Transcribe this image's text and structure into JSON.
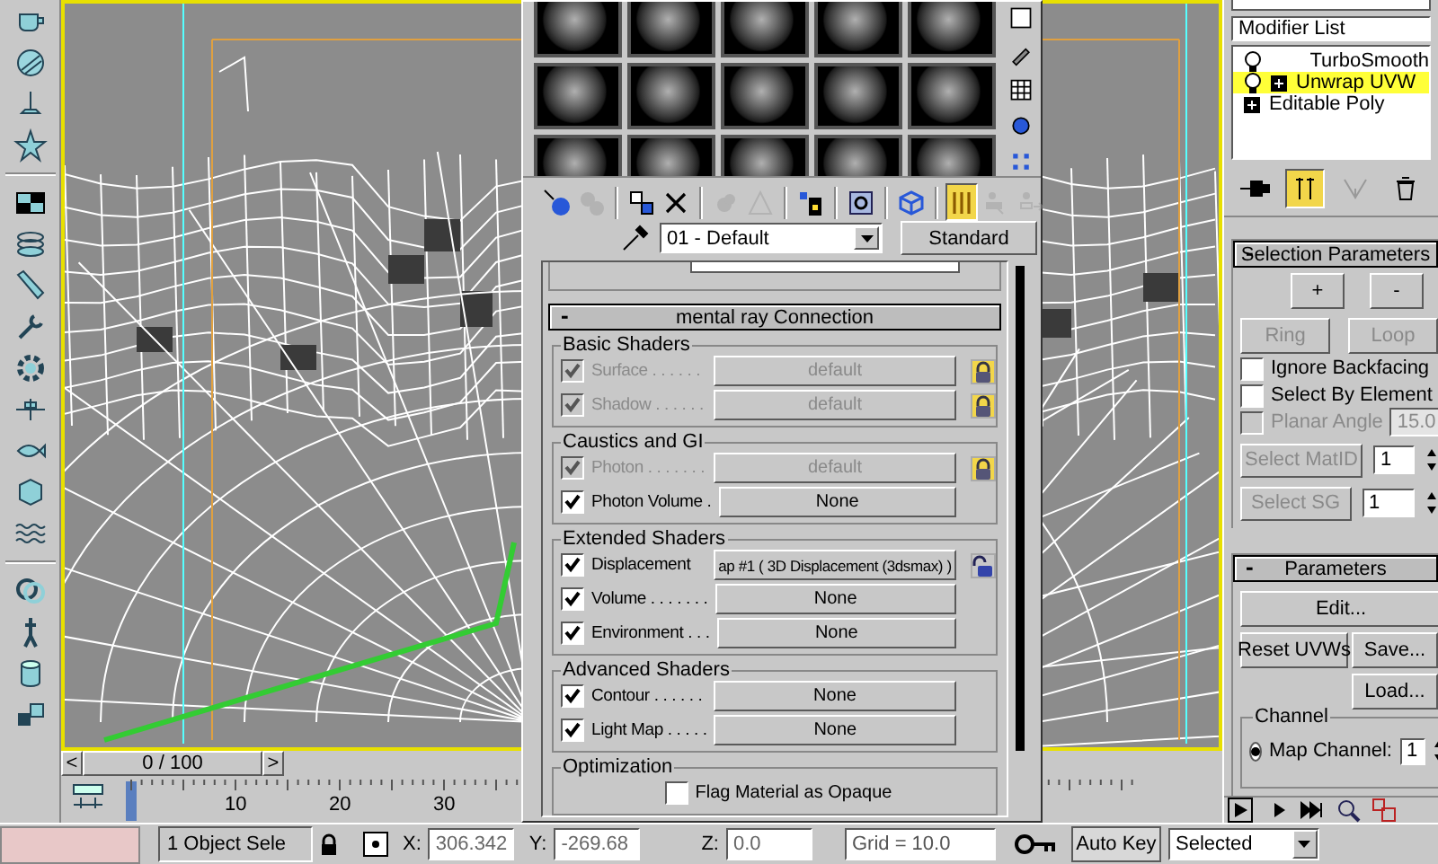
{
  "material_editor": {
    "toolbar": [
      {
        "kind": "sphere-arrow",
        "active": false,
        "disabled": false
      },
      {
        "kind": "sphere-swap",
        "active": false,
        "disabled": true
      },
      {
        "kind": "boxes",
        "active": false,
        "disabled": false
      },
      {
        "kind": "cross",
        "active": false,
        "disabled": false
      },
      {
        "kind": "blob",
        "active": false,
        "disabled": true
      },
      {
        "kind": "triangle",
        "active": false,
        "disabled": true
      },
      {
        "kind": "library",
        "active": false,
        "disabled": false
      },
      {
        "kind": "disk",
        "active": false,
        "disabled": false
      },
      {
        "kind": "checker-cube",
        "active": false,
        "disabled": false
      },
      {
        "kind": "bars",
        "active": true,
        "disabled": false
      },
      {
        "kind": "figure",
        "active": false,
        "disabled": true
      },
      {
        "kind": "figure-arrow",
        "active": false,
        "disabled": true
      }
    ],
    "material_name": "01 - Default",
    "material_type": "Standard",
    "rollout": {
      "toggle": "-",
      "title": "mental ray Connection"
    },
    "groups": [
      {
        "title": "Basic Shaders",
        "rows": [
          {
            "kind": "shader",
            "label": "Surface . . . . . .",
            "checked": true,
            "disabled": true,
            "value": "default",
            "locked": true
          },
          {
            "kind": "shader",
            "label": "Shadow . . . . . .",
            "checked": true,
            "disabled": true,
            "value": "default",
            "locked": true
          }
        ]
      },
      {
        "title": "Caustics and GI",
        "rows": [
          {
            "kind": "shader",
            "label": "Photon . . . . . . .",
            "checked": true,
            "disabled": true,
            "value": "default",
            "locked": true
          },
          {
            "kind": "shader",
            "label": "Photon Volume .",
            "checked": true,
            "disabled": false,
            "value": "None"
          }
        ]
      },
      {
        "title": "Extended Shaders",
        "rows": [
          {
            "kind": "shader",
            "label": "Displacement",
            "checked": true,
            "disabled": false,
            "value": "ap #1 ( 3D Displacement (3dsmax) )",
            "locked": false
          },
          {
            "kind": "shader",
            "label": "Volume . . . . . . .",
            "checked": true,
            "disabled": false,
            "value": "None"
          },
          {
            "kind": "shader",
            "label": "Environment . . .",
            "checked": true,
            "disabled": false,
            "value": "None"
          }
        ]
      },
      {
        "title": "Advanced Shaders",
        "rows": [
          {
            "kind": "shader",
            "label": "Contour . . . . . .",
            "checked": true,
            "disabled": false,
            "value": "None"
          },
          {
            "kind": "shader",
            "label": "Light Map . . . . .",
            "checked": true,
            "disabled": false,
            "value": "None"
          }
        ]
      },
      {
        "title": "Optimization",
        "rows": [
          {
            "kind": "option",
            "label": "Flag Material as Opaque",
            "checked": false,
            "disabled": false
          }
        ]
      }
    ]
  },
  "command_panel": {
    "modifier_list": "Modifier List",
    "stack": [
      {
        "label": "TurboSmooth",
        "bulb": true,
        "expandable": false,
        "selected": false
      },
      {
        "label": "Unwrap UVW",
        "bulb": true,
        "expandable": true,
        "selected": true
      },
      {
        "label": "Editable Poly",
        "bulb": false,
        "expandable": true,
        "selected": false
      }
    ],
    "stack_tools": [
      {
        "kind": "pin",
        "active": false,
        "disabled": false
      },
      {
        "kind": "end-result",
        "active": true,
        "disabled": false
      },
      {
        "kind": "unique",
        "active": false,
        "disabled": true
      },
      {
        "kind": "remove",
        "active": false,
        "disabled": false
      }
    ],
    "selection_rollout": {
      "toggle": "-",
      "title": "Selection Parameters",
      "buttons": [
        {
          "label": "+",
          "disabled": false
        },
        {
          "label": "-",
          "disabled": false
        },
        {
          "label": "Ring",
          "disabled": true
        },
        {
          "label": "Loop",
          "disabled": true
        }
      ],
      "options": [
        {
          "kind": "checkbox",
          "label": "Ignore Backfacing",
          "checked": false,
          "disabled": false
        },
        {
          "kind": "checkbox",
          "label": "Select By Element",
          "checked": false,
          "disabled": false
        },
        {
          "kind": "check-spinner",
          "label": "Planar Angle",
          "checked": false,
          "disabled": true,
          "value": "15.0"
        },
        {
          "kind": "button-spinner",
          "label": "Select MatID",
          "disabled": true,
          "value": "1"
        },
        {
          "kind": "button-spinner",
          "label": "Select SG",
          "disabled": true,
          "value": "1"
        }
      ]
    },
    "parameters_rollout": {
      "toggle": "-",
      "title": "Parameters",
      "edit": "Edit...",
      "reset": "Reset UVWs",
      "save": "Save...",
      "load": "Load...",
      "channel": {
        "title": "Channel",
        "label": "Map Channel:",
        "selected": true,
        "value": "1"
      }
    }
  },
  "time_slider": {
    "prev": "<",
    "label": "0 / 100",
    "next": ">",
    "ruler_labels": [
      "10",
      "20",
      "30"
    ]
  },
  "status_bar": {
    "selection": "1 Object Sele",
    "coords": [
      {
        "axis": "X:",
        "value": "306.342"
      },
      {
        "axis": "Y:",
        "value": "-269.68"
      },
      {
        "axis": "Z:",
        "value": "0.0"
      }
    ],
    "grid": "Grid = 10.0",
    "auto_key": "Auto Key",
    "key_filter": "Selected"
  }
}
